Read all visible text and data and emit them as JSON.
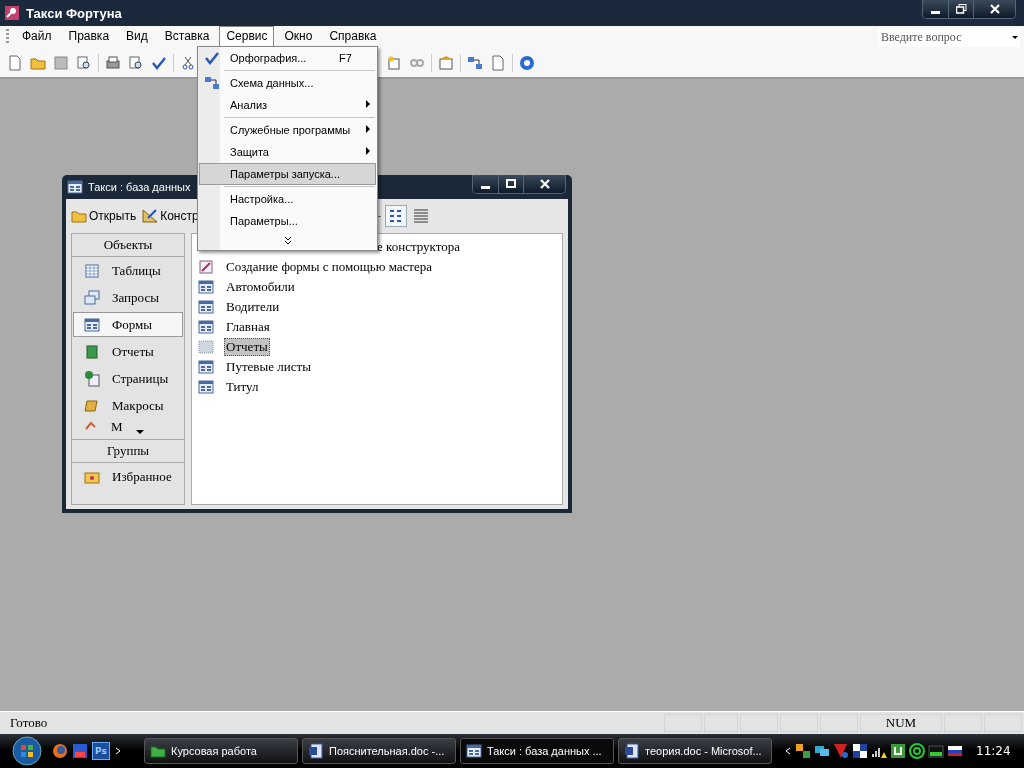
{
  "window": {
    "title": "Такси Фортуна"
  },
  "menu_bar": [
    {
      "label": "Файл",
      "selected": false
    },
    {
      "label": "Правка",
      "selected": false
    },
    {
      "label": "Вид",
      "selected": false
    },
    {
      "label": "Вставка",
      "selected": false
    },
    {
      "label": "Сервис",
      "selected": true
    },
    {
      "label": "Окно",
      "selected": false
    },
    {
      "label": "Справка",
      "selected": false
    }
  ],
  "help_search": {
    "placeholder": "Введите вопрос"
  },
  "service_menu": [
    {
      "kind": "item",
      "label": "Орфография...",
      "shortcut": "F7",
      "selected": false
    },
    {
      "kind": "separator"
    },
    {
      "kind": "item",
      "label": "Схема данных...",
      "selected": false
    },
    {
      "kind": "submenu",
      "label": "Анализ",
      "selected": false
    },
    {
      "kind": "separator"
    },
    {
      "kind": "submenu",
      "label": "Служебные программы",
      "selected": false
    },
    {
      "kind": "submenu",
      "label": "Защита",
      "selected": false
    },
    {
      "kind": "item",
      "label": "Параметры запуска...",
      "selected": true
    },
    {
      "kind": "separator"
    },
    {
      "kind": "item",
      "label": "Настройка...",
      "selected": false
    },
    {
      "kind": "item",
      "label": "Параметры...",
      "selected": false
    },
    {
      "kind": "more"
    }
  ],
  "db_window": {
    "title": "Такси : база данных",
    "toolbar": [
      {
        "kind": "open",
        "label": "Открыть"
      },
      {
        "kind": "design",
        "label": "Констр"
      }
    ],
    "objects_header": "Объекты",
    "objects": [
      {
        "kind": "tables",
        "label": "Таблицы",
        "selected": false
      },
      {
        "kind": "queries",
        "label": "Запросы",
        "selected": false
      },
      {
        "kind": "forms",
        "label": "Формы",
        "selected": true
      },
      {
        "kind": "reports",
        "label": "Отчеты",
        "selected": false
      },
      {
        "kind": "pages",
        "label": "Страницы",
        "selected": false
      },
      {
        "kind": "macros",
        "label": "Макросы",
        "selected": false
      },
      {
        "kind": "modules",
        "label": "М"
      }
    ],
    "groups_header": "Группы",
    "groups": [
      {
        "label": "Избранное"
      }
    ],
    "list": [
      {
        "kind": "cut",
        "label": "е конструктора",
        "selected": false
      },
      {
        "kind": "wizard",
        "label": "Создание формы с помощью мастера",
        "selected": false
      },
      {
        "kind": "form",
        "label": "Автомобили",
        "selected": false
      },
      {
        "kind": "form",
        "label": "Водители",
        "selected": false
      },
      {
        "kind": "form",
        "label": "Главная",
        "selected": false
      },
      {
        "kind": "grid",
        "label": "Отчеты",
        "selected": true
      },
      {
        "kind": "form",
        "label": "Путевые листы",
        "selected": false
      },
      {
        "kind": "form",
        "label": "Титул",
        "selected": false
      }
    ]
  },
  "status_bar": {
    "text": "Готово",
    "indicator": "NUM"
  },
  "taskbar": {
    "quick_launch_label": "Ps",
    "tasks": [
      {
        "kind": "folder",
        "label": "Курсовая работа",
        "selected": false
      },
      {
        "kind": "word",
        "label": "Пояснительная.doc -...",
        "selected": false
      },
      {
        "kind": "access",
        "label": "Такси : база данных ...",
        "selected": true
      },
      {
        "kind": "word",
        "label": "теория.doc - Microsof...",
        "selected": false
      }
    ],
    "clock": "11:24"
  }
}
